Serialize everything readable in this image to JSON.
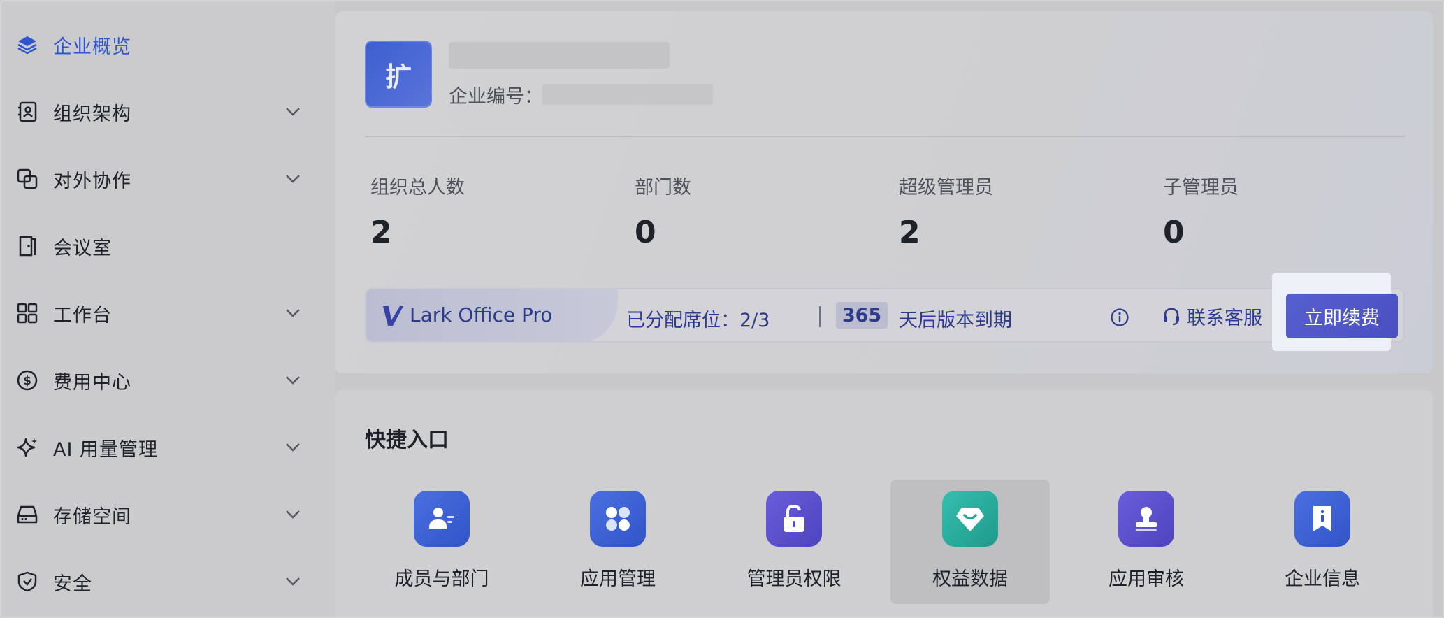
{
  "sidebar": {
    "items": [
      {
        "label": "企业概览",
        "icon": "layers-icon",
        "active": true,
        "expandable": false
      },
      {
        "label": "组织架构",
        "icon": "contacts-book-icon",
        "expandable": true
      },
      {
        "label": "对外协作",
        "icon": "link-squares-icon",
        "expandable": true
      },
      {
        "label": "会议室",
        "icon": "door-icon",
        "expandable": false
      },
      {
        "label": "工作台",
        "icon": "grid-icon",
        "expandable": true
      },
      {
        "label": "费用中心",
        "icon": "dollar-circle-icon",
        "expandable": true
      },
      {
        "label": "AI 用量管理",
        "icon": "sparkle-icon",
        "expandable": true
      },
      {
        "label": "存储空间",
        "icon": "drive-icon",
        "expandable": true
      },
      {
        "label": "安全",
        "icon": "shield-icon",
        "expandable": true
      }
    ]
  },
  "org": {
    "avatar_text": "扩",
    "id_label": "企业编号："
  },
  "stats": [
    {
      "label": "组织总人数",
      "value": "2"
    },
    {
      "label": "部门数",
      "value": "0"
    },
    {
      "label": "超级管理员",
      "value": "2"
    },
    {
      "label": "子管理员",
      "value": "0"
    }
  ],
  "plan": {
    "name": "Lark Office Pro",
    "seats": "已分配席位：2/3",
    "days": "365",
    "days_text": "天后版本到期",
    "contact_label": "联系客服",
    "renew_label": "立即续费"
  },
  "quick": {
    "title": "快捷入口",
    "items": [
      {
        "label": "成员与部门",
        "icon": "members-icon",
        "color": "#3f63d3"
      },
      {
        "label": "应用管理",
        "icon": "apps-icon",
        "color": "#3f63d3"
      },
      {
        "label": "管理员权限",
        "icon": "unlock-icon",
        "color": "#5b4fc9"
      },
      {
        "label": "权益数据",
        "icon": "benefit-gem-icon",
        "color": "#26a89a",
        "active": true
      },
      {
        "label": "应用审核",
        "icon": "stamp-icon",
        "color": "#5b4fc9"
      },
      {
        "label": "企业信息",
        "icon": "info-bookmark-icon",
        "color": "#3f63d3"
      }
    ]
  },
  "colors": {
    "accent": "#2e56c9",
    "renew": "#5059c8",
    "plan_text": "#2e3a8c"
  }
}
